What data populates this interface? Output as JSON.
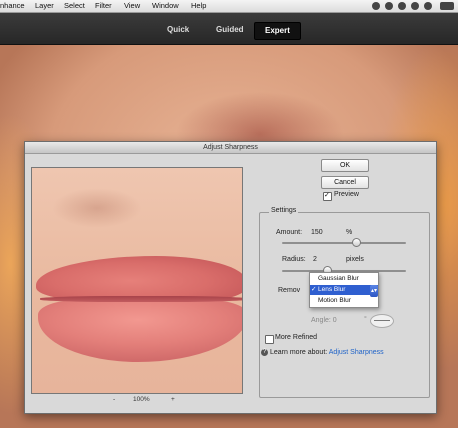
{
  "menubar": {
    "items": [
      "Enhance",
      "Layer",
      "Select",
      "Filter",
      "View",
      "Window",
      "Help"
    ],
    "menu_label_visible_0": "nhance",
    "tray_icons": [
      "sync-icon",
      "bluetooth-icon",
      "timemachine-icon",
      "wifi-icon",
      "volume-icon",
      "battery-icon"
    ]
  },
  "modes": {
    "quick": "Quick",
    "guided": "Guided",
    "expert": "Expert",
    "active": "Expert"
  },
  "dialog": {
    "title": "Adjust Sharpness",
    "ok": "OK",
    "cancel": "Cancel",
    "preview_label": "Preview",
    "preview_checked": true,
    "zoom": {
      "minus": "-",
      "value": "100%",
      "plus": "+"
    },
    "settings": {
      "legend": "Settings",
      "amount_label": "Amount:",
      "amount_value": "150",
      "amount_unit": "%",
      "amount_slider_fraction": 0.6,
      "radius_label": "Radius:",
      "radius_value": "2",
      "radius_unit": "pixels",
      "radius_slider_fraction": 0.36,
      "remove_label": "Remov",
      "remove_options": [
        "Gaussian Blur",
        "Lens Blur",
        "Motion Blur"
      ],
      "remove_selected": "Lens Blur",
      "tick": "✓",
      "angle_label": "Angle: 0",
      "angle_unit": "°",
      "more_refined_label": "More Refined",
      "more_refined_checked": false,
      "learn_prefix": "Learn more about:",
      "learn_link": "Adjust Sharpness"
    }
  },
  "colors": {
    "accent": "#2f5fd0",
    "link": "#1f63c8",
    "modebar": "#2f2f2f"
  }
}
